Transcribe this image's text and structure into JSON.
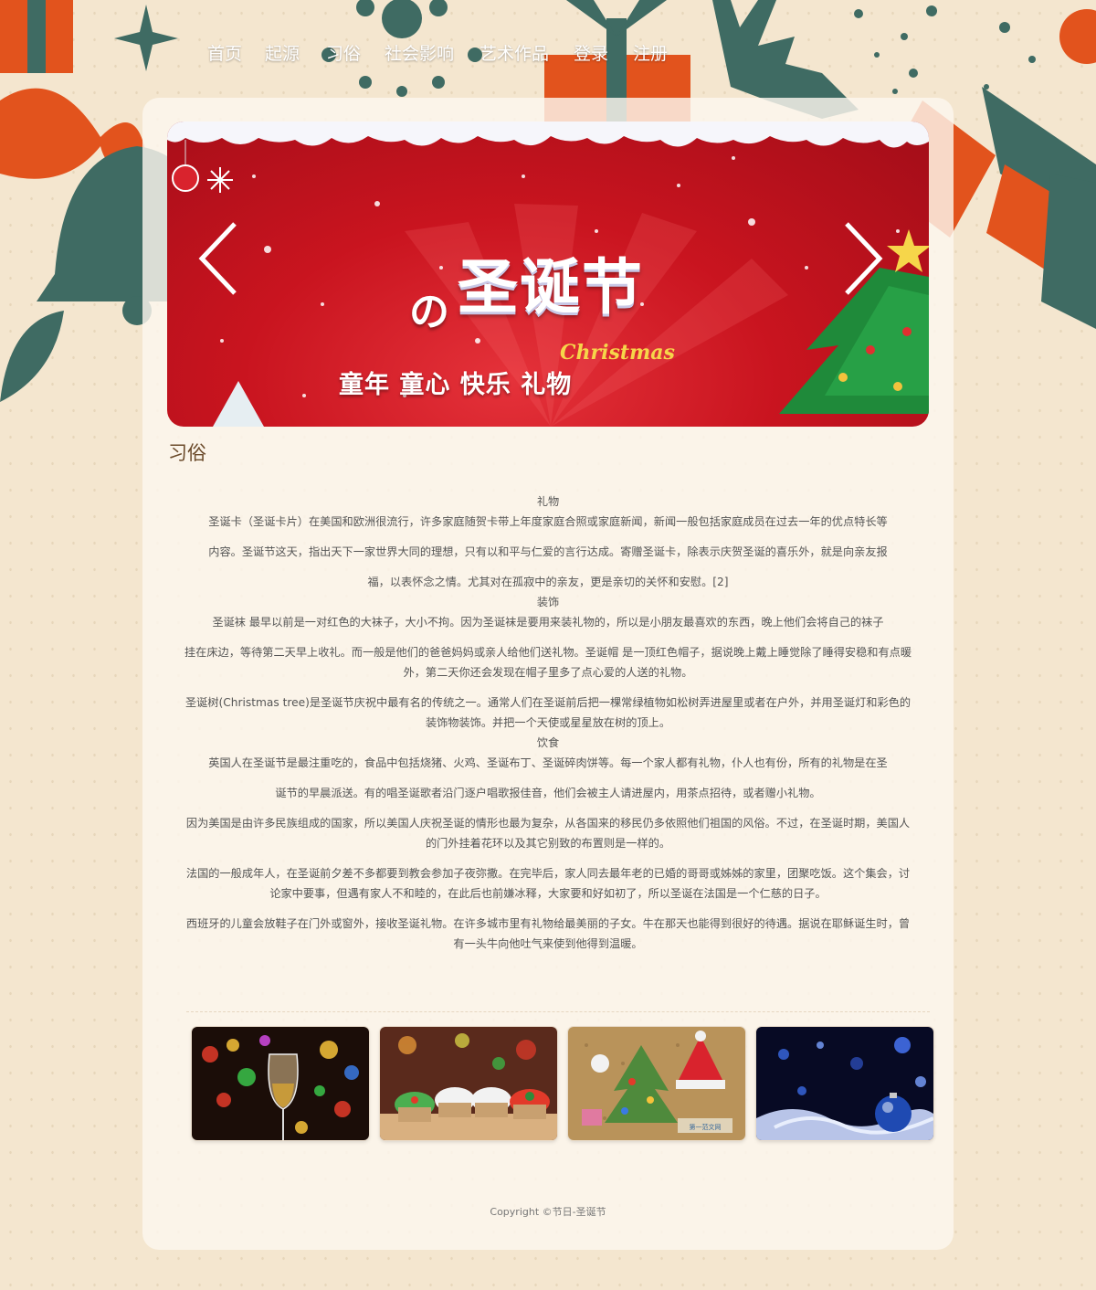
{
  "nav": {
    "items": [
      {
        "label": "首页"
      },
      {
        "label": "起源"
      },
      {
        "label": "习俗"
      },
      {
        "label": "社会影响"
      },
      {
        "label": "艺术作品"
      },
      {
        "label": "登录"
      },
      {
        "label": "注册"
      }
    ]
  },
  "banner": {
    "title": "圣诞节",
    "prefix": "の",
    "english": "Christmas",
    "subtitle": "童年 童心 快乐 礼物"
  },
  "section": {
    "title": "习俗"
  },
  "article": {
    "gift_heading": "礼物",
    "gift_lines": [
      "圣诞卡（圣诞卡片）在美国和欧洲很流行，许多家庭随贺卡带上年度家庭合照或家庭新闻，新闻一般包括家庭成员在过去一年的优点特长等",
      "内容。圣诞节这天，指出天下一家世界大同的理想，只有以和平与仁爱的言行达成。寄赠圣诞卡，除表示庆贺圣诞的喜乐外，就是向亲友报",
      "福，以表怀念之情。尤其对在孤寂中的亲友，更是亲切的关怀和安慰。[2]"
    ],
    "decor_heading": "装饰",
    "decor_line1": "圣诞袜 最早以前是一对红色的大袜子，大小不拘。因为圣诞袜是要用来装礼物的，所以是小朋友最喜欢的东西，晚上他们会将自己的袜子",
    "decor_p2": "挂在床边，等待第二天早上收礼。而一般是他们的爸爸妈妈或亲人给他们送礼物。圣诞帽 是一顶红色帽子，据说晚上戴上睡觉除了睡得安稳和有点暖外，第二天你还会发现在帽子里多了点心爱的人送的礼物。",
    "decor_p3": "圣诞树(Christmas tree)是圣诞节庆祝中最有名的传统之一。通常人们在圣诞前后把一棵常绿植物如松树弄进屋里或者在户外，并用圣诞灯和彩色的装饰物装饰。并把一个天使或星星放在树的顶上。",
    "food_heading": "饮食",
    "food_lines": [
      "英国人在圣诞节是最注重吃的，食品中包括烧猪、火鸡、圣诞布丁、圣诞碎肉饼等。每一个家人都有礼物，仆人也有份，所有的礼物是在圣",
      "诞节的早晨派送。有的唱圣诞歌者沿门逐户唱歌报佳音，他们会被主人请进屋内，用茶点招待，或者赠小礼物。"
    ],
    "us_p": "因为美国是由许多民族组成的国家，所以美国人庆祝圣诞的情形也最为复杂，从各国来的移民仍多依照他们祖国的风俗。不过，在圣诞时期，美国人的门外挂着花环以及其它别致的布置则是一样的。",
    "fr_p": "法国的一般成年人，在圣诞前夕差不多都要到教会参加子夜弥撒。在完毕后，家人同去最年老的已婚的哥哥或姊姊的家里，团聚吃饭。这个集会，讨论家中要事，但遇有家人不和睦的，在此后也前嫌冰释，大家要和好如初了，所以圣诞在法国是一个仁慈的日子。",
    "es_p": "西班牙的儿童会放鞋子在门外或窗外，接收圣诞礼物。在许多城市里有礼物给最美丽的子女。牛在那天也能得到很好的待遇。据说在耶稣诞生时，曾有一头牛向他吐气来使到他得到温暖。"
  },
  "gallery": {
    "thumb3_caption": "第一范文网"
  },
  "footer": {
    "copyright": "Copyright ©节日-圣诞节"
  },
  "colors": {
    "page_bg": "#f4e6cf",
    "banner_red": "#c9141f",
    "deco_green": "#3f6b63",
    "deco_orange": "#e2531d",
    "section_title": "#6b4a2a"
  }
}
